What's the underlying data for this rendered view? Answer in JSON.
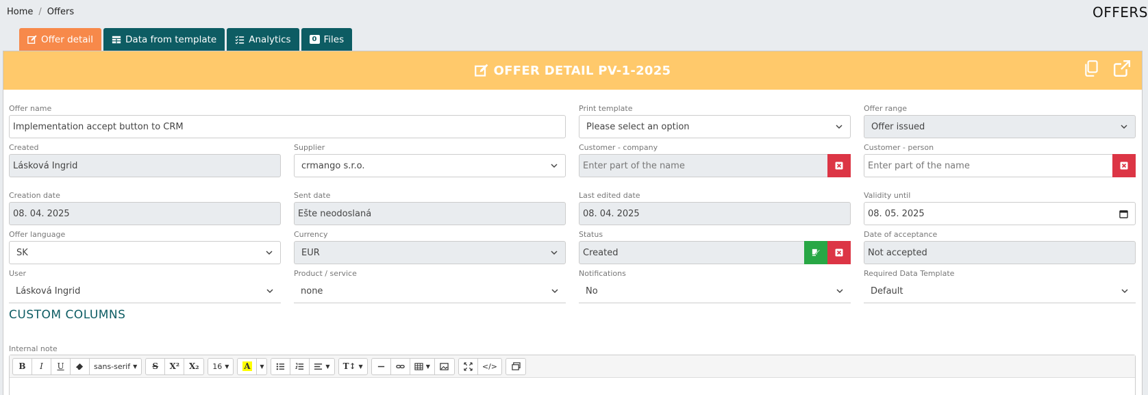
{
  "breadcrumb": {
    "home": "Home",
    "separator": "/",
    "current": "Offers"
  },
  "page_title": "OFFERS",
  "tabs": [
    {
      "label": "Offer detail",
      "icon": "edit-icon",
      "active": true
    },
    {
      "label": "Data from template",
      "icon": "table-icon",
      "active": false
    },
    {
      "label": "Analytics",
      "icon": "list-check-icon",
      "active": false
    },
    {
      "label": "Files",
      "icon": "badge",
      "badge": "0",
      "active": false
    }
  ],
  "header": {
    "title": "OFFER DETAIL PV-1-2025",
    "color": "#ffc96b"
  },
  "form": {
    "offer_name": {
      "label": "Offer name",
      "value": "Implementation accept button to CRM"
    },
    "print_template": {
      "label": "Print template",
      "value": "Please select an option"
    },
    "offer_range": {
      "label": "Offer range",
      "value": "Offer issued"
    },
    "created": {
      "label": "Created",
      "value": "Lásková Ingrid"
    },
    "supplier": {
      "label": "Supplier",
      "value": "crmango s.r.o."
    },
    "customer_company": {
      "label": "Customer - company",
      "placeholder": "Enter part of the name"
    },
    "customer_person": {
      "label": "Customer - person",
      "placeholder": "Enter part of the name"
    },
    "creation_date": {
      "label": "Creation date",
      "value": "08. 04. 2025"
    },
    "sent_date": {
      "label": "Sent date",
      "value": "Ešte neodoslaná"
    },
    "last_edited_date": {
      "label": "Last edited date",
      "value": "08. 04. 2025"
    },
    "validity_until": {
      "label": "Validity until",
      "value": "08. 05. 2025"
    },
    "offer_language": {
      "label": "Offer language",
      "value": "SK"
    },
    "currency": {
      "label": "Currency",
      "value": "EUR"
    },
    "status": {
      "label": "Status",
      "value": "Created"
    },
    "date_of_acceptance": {
      "label": "Date of acceptance",
      "value": "Not accepted"
    },
    "user": {
      "label": "User",
      "value": "Lásková Ingrid"
    },
    "product_service": {
      "label": "Product / service",
      "value": "none"
    },
    "notifications": {
      "label": "Notifications",
      "value": "No"
    },
    "required_data_template": {
      "label": "Required Data Template",
      "value": "Default"
    }
  },
  "custom_columns_title": "CUSTOM COLUMNS",
  "internal_note": {
    "label": "Internal note",
    "toolbar": {
      "bold": "B",
      "italic": "I",
      "underline": "U",
      "font_family": "sans-serif",
      "strike": "S",
      "superscript": "X²",
      "subscript": "X₂",
      "font_size": "16",
      "color": "A",
      "line_height": "T↕"
    }
  },
  "colors": {
    "tab": "#0d5c63",
    "tab_active": "#f7894a",
    "danger": "#dc3545",
    "success": "#28a745"
  }
}
